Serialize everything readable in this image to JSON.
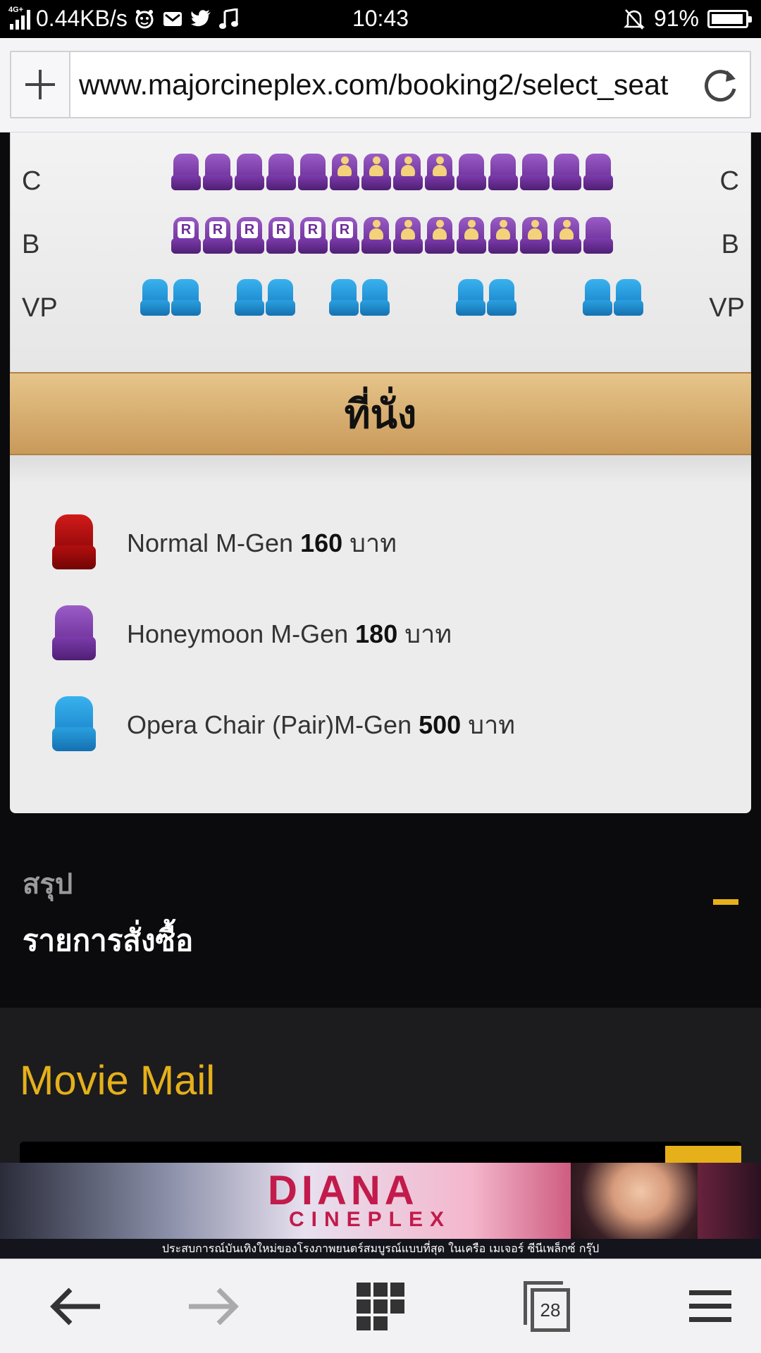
{
  "status_bar": {
    "network": "4G+",
    "speed": "0.44KB/s",
    "time": "10:43",
    "battery": "91%",
    "battery_level": 0.91
  },
  "browser": {
    "url": "www.majorcineplex.com/booking2/select_seat"
  },
  "seat_map": {
    "rows": [
      {
        "label": "C"
      },
      {
        "label": "B"
      },
      {
        "label": "VP"
      }
    ],
    "reserved_mark": "R"
  },
  "legend": {
    "title": "ที่นั่ง",
    "items": [
      {
        "name": "Normal M-Gen",
        "price": "160",
        "currency": "บาท",
        "color": "#b00e0e"
      },
      {
        "name": "Honeymoon M-Gen",
        "price": "180",
        "currency": "บาท",
        "color": "#7a38a8"
      },
      {
        "name": "Opera Chair (Pair)M-Gen",
        "price": "500",
        "currency": "บาท",
        "color": "#1f95d8"
      }
    ]
  },
  "summary": {
    "label": "สรุป",
    "title": "รายการสั่งซื้อ"
  },
  "movie_mail": {
    "title": "Movie Mail"
  },
  "banner": {
    "title": "DIANA",
    "subtitle": "CINEPLEX",
    "tagline": "ประสบการณ์บันเทิงใหม่ของโรงภาพยนตร์สมบูรณ์แบบที่สุด ในเครือ เมเจอร์ ซีนีเพล็กซ์ กรุ๊ป"
  },
  "bottom_nav": {
    "tab_count": "28"
  },
  "colors": {
    "accent": "#e5b01a",
    "purple_seat": "#7a38a8",
    "blue_seat": "#1f95d8",
    "red_seat": "#b00e0e",
    "occupied_person": "#f4d27a"
  }
}
